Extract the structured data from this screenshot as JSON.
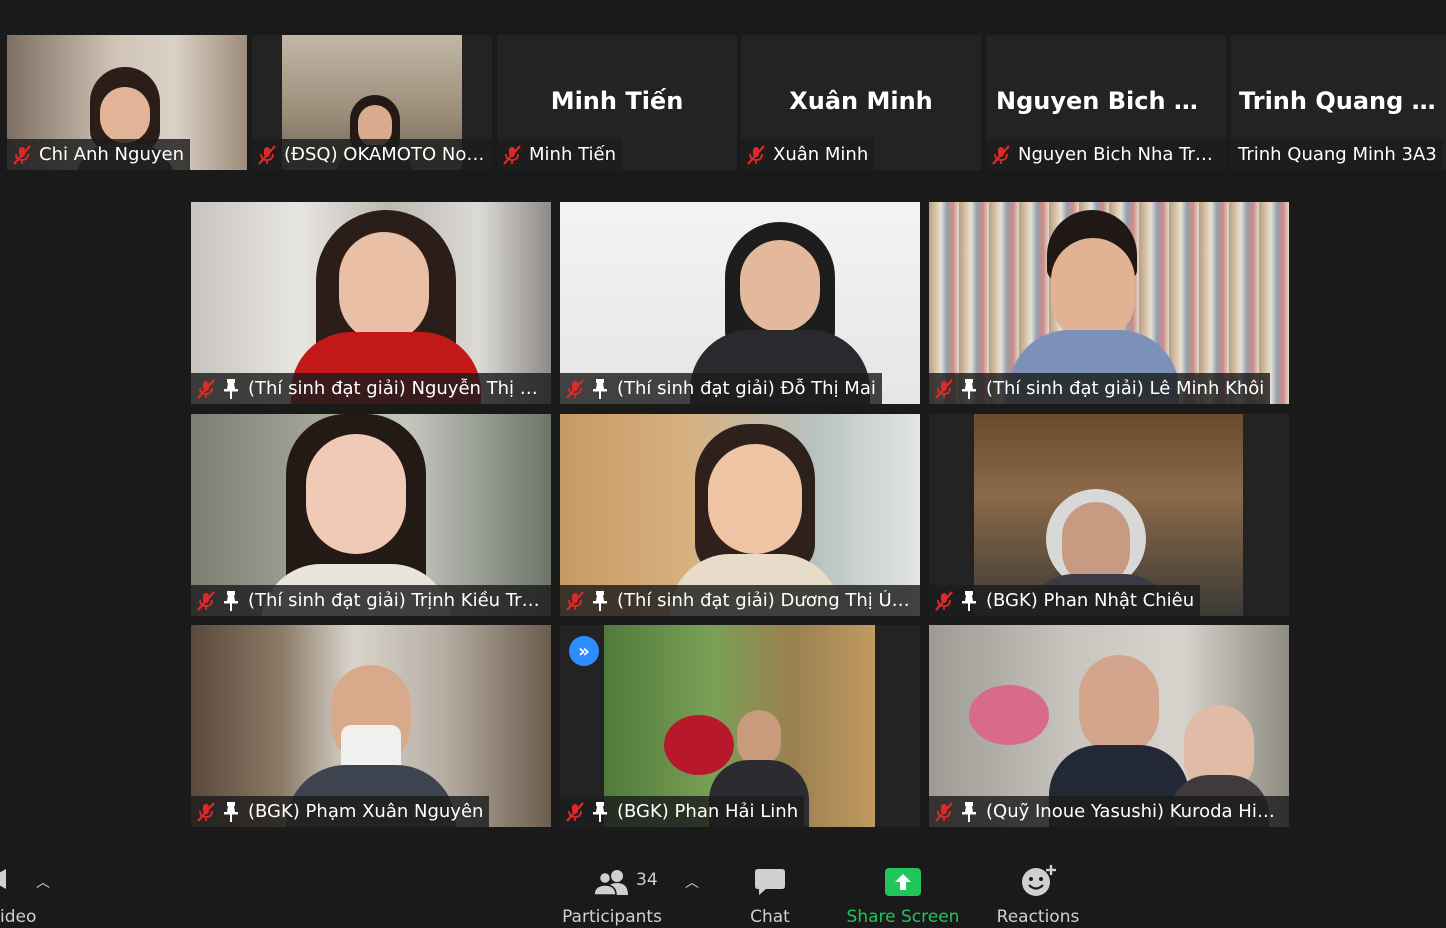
{
  "strip": [
    {
      "name": "Chi Anh Nguyen",
      "type": "video"
    },
    {
      "name": "(ĐSQ) OKAMOTO Nori...",
      "type": "video"
    },
    {
      "name": "Minh Tiến",
      "display": "Minh Tiến",
      "type": "text"
    },
    {
      "name": "Xuân Minh",
      "display": "Xuân Minh",
      "type": "text"
    },
    {
      "name": "Nguyen Bich Nha Truc...",
      "display": "Nguyen Bich N...",
      "type": "text"
    },
    {
      "name": "Trinh Quang Minh 3A3",
      "display": "Trinh Quang Mi...",
      "type": "text"
    }
  ],
  "grid": [
    {
      "name": "(Thí sinh đạt giải) Nguyễn Thị Hu..."
    },
    {
      "name": "(Thí sinh đạt giải) Đỗ Thị Mai"
    },
    {
      "name": "(Thí sinh đạt giải) Lê Minh Khôi"
    },
    {
      "name": "(Thí sinh đạt giải) Trịnh Kiều Trang"
    },
    {
      "name": "(Thí sinh đạt giải) Dương Thị Út G..."
    },
    {
      "name": "(BGK) Phan Nhật Chiêu"
    },
    {
      "name": "(BGK) Phạm Xuân Nguyên"
    },
    {
      "name": "(BGK) Phan Hải Linh"
    },
    {
      "name": "(Quỹ Inoue Yasushi) Kuroda Hide..."
    }
  ],
  "toolbar": {
    "video_label": "ideo",
    "participants_label": "Participants",
    "participants_count": "34",
    "chat_label": "Chat",
    "share_label": "Share Screen",
    "reactions_label": "Reactions"
  },
  "colors": {
    "background": "#1a1a1a",
    "tile": "#232323",
    "mute_red": "#e02828",
    "share_green": "#22c45c",
    "speaker_blue": "#2d8cff"
  }
}
